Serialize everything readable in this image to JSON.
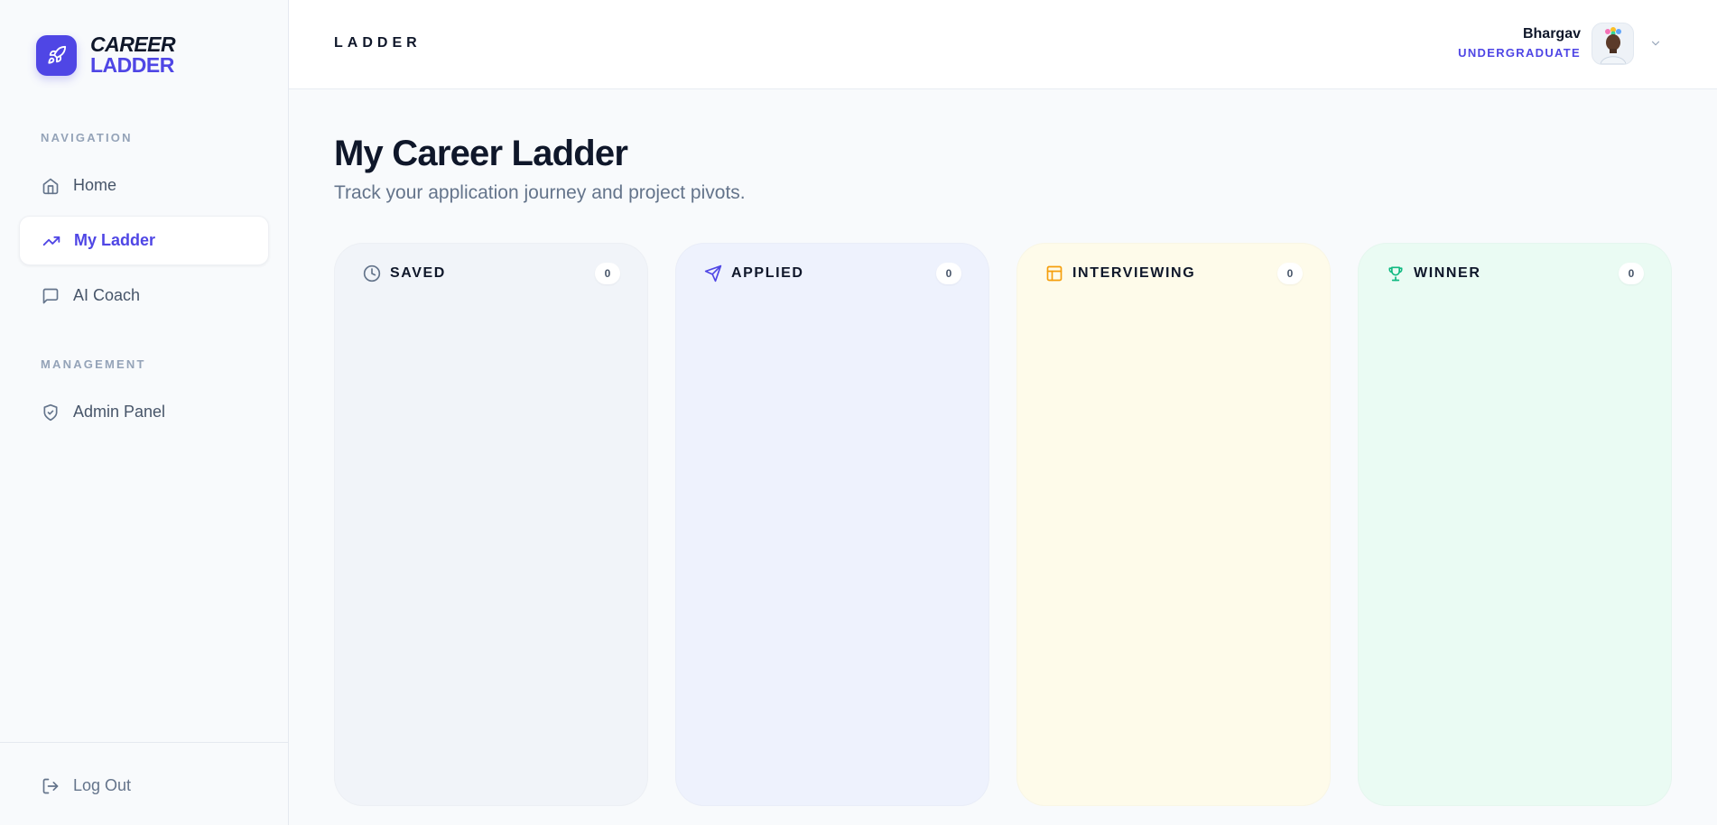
{
  "brand": {
    "line1": "CAREER",
    "line2": "LADDER",
    "accent": "#4f46e5",
    "icon": "rocket-icon"
  },
  "sidebar": {
    "sections": [
      {
        "label": "NAVIGATION"
      },
      {
        "label": "MANAGEMENT"
      }
    ],
    "items": [
      {
        "label": "Home",
        "icon": "home-icon",
        "active": false
      },
      {
        "label": "My Ladder",
        "icon": "trending-up-icon",
        "active": true
      },
      {
        "label": "AI Coach",
        "icon": "chat-icon",
        "active": false
      },
      {
        "label": "Admin Panel",
        "icon": "shield-icon",
        "active": false
      }
    ],
    "logout": {
      "label": "Log Out",
      "icon": "logout-icon"
    }
  },
  "header": {
    "title": "LADDER",
    "user": {
      "name": "Bhargav",
      "role": "UNDERGRADUATE"
    }
  },
  "main": {
    "title": "My Career Ladder",
    "subtitle": "Track your application journey and project pivots.",
    "columns": [
      {
        "label": "SAVED",
        "count": "0",
        "icon": "clock-icon",
        "bg": "#f1f4f9",
        "iconColor": "#64748b"
      },
      {
        "label": "APPLIED",
        "count": "0",
        "icon": "send-icon",
        "bg": "#eef2fd",
        "iconColor": "#4f46e5"
      },
      {
        "label": "INTERVIEWING",
        "count": "0",
        "icon": "layout-icon",
        "bg": "#fefbea",
        "iconColor": "#f59e0b"
      },
      {
        "label": "WINNER",
        "count": "0",
        "icon": "trophy-icon",
        "bg": "#eafbf3",
        "iconColor": "#10b981"
      }
    ]
  }
}
